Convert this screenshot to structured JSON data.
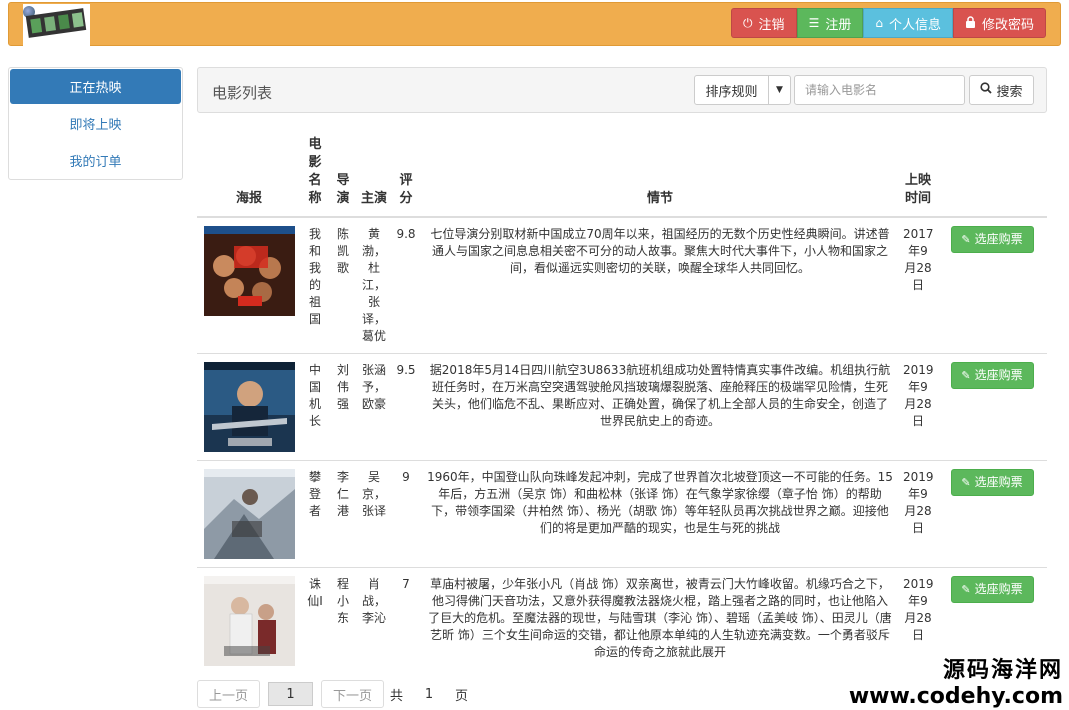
{
  "header": {
    "buttons": {
      "logout": "注销",
      "register": "注册",
      "profile": "个人信息",
      "change_password": "修改密码"
    },
    "colors": {
      "bar": "#f0ad4e",
      "danger": "#d9534f",
      "success": "#5cb85c",
      "info": "#5bc0de"
    }
  },
  "sidebar": {
    "items": [
      {
        "label": "正在热映",
        "active": true
      },
      {
        "label": "即将上映",
        "active": false
      },
      {
        "label": "我的订单",
        "active": false
      }
    ]
  },
  "panel": {
    "title": "电影列表",
    "sort_label": "排序规则",
    "search_placeholder": "请输入电影名",
    "search_button": "搜索"
  },
  "table": {
    "headers": {
      "poster": "海报",
      "name": "电影名称",
      "director": "导演",
      "cast": "主演",
      "rating": "评分",
      "plot": "情节",
      "release": "上映时间"
    },
    "buy_label": "选座购票",
    "rows": [
      {
        "name": "我和我的祖国",
        "director": "陈凯歌",
        "cast": "黄渤，杜江，张译，葛优",
        "rating": "9.8",
        "plot": "七位导演分别取材新中国成立70周年以来，祖国经历的无数个历史性经典瞬间。讲述普通人与国家之间息息相关密不可分的动人故事。聚焦大时代大事件下，小人物和国家之间，看似遥远实则密切的关联，唤醒全球华人共同回忆。",
        "release": "2017年9月28日"
      },
      {
        "name": "中国机长",
        "director": "刘伟强",
        "cast": "张涵予，欧豪",
        "rating": "9.5",
        "plot": "据2018年5月14日四川航空3U8633航班机组成功处置特情真实事件改编。机组执行航班任务时，在万米高空突遇驾驶舱风挡玻璃爆裂脱落、座舱释压的极端罕见险情，生死关头，他们临危不乱、果断应对、正确处置，确保了机上全部人员的生命安全，创造了世界民航史上的奇迹。",
        "release": "2019年9月28日"
      },
      {
        "name": "攀登者",
        "director": "李仁港",
        "cast": "吴京，张译",
        "rating": "9",
        "plot": "1960年，中国登山队向珠峰发起冲刺，完成了世界首次北坡登顶这一不可能的任务。15 年后，方五洲（吴京 饰）和曲松林（张译 饰）在气象学家徐缨（章子怡 饰）的帮助下，带领李国梁（井柏然 饰）、杨光（胡歌 饰）等年轻队员再次挑战世界之巅。迎接他们的将是更加严酷的现实，也是生与死的挑战",
        "release": "2019年9月28日"
      },
      {
        "name": "诛仙Ⅰ",
        "director": "程小东",
        "cast": "肖战，李沁",
        "rating": "7",
        "plot": "草庙村被屠，少年张小凡（肖战 饰）双亲离世，被青云门大竹峰收留。机缘巧合之下，他习得佛门天音功法，又意外获得魔教法器烧火棍，踏上强者之路的同时，也让他陷入了巨大的危机。至魔法器的现世，与陆雪琪（李沁 饰）、碧瑶（孟美岐 饰）、田灵儿（唐艺昕 饰）三个女生间命运的交错，都让他原本单纯的人生轨迹充满变数。一个勇者驳斥命运的传奇之旅就此展开",
        "release": "2019年9月28日"
      }
    ]
  },
  "pager": {
    "prev": "上一页",
    "current": "1",
    "next": "下一页",
    "total_prefix": "共",
    "total": "1",
    "total_suffix": "页"
  },
  "watermark": {
    "line1": "源码海洋网",
    "line2": "www.codehy.com"
  }
}
